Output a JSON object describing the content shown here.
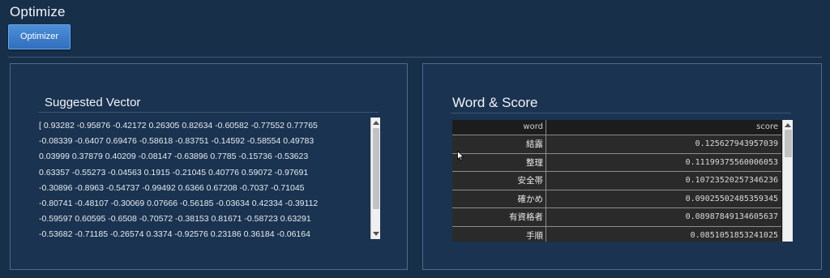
{
  "page": {
    "title": "Optimize",
    "optimize_button": "Optimizer"
  },
  "vector_panel": {
    "heading": "Suggested Vector",
    "lines": [
      "[ 0.93282 -0.95876 -0.42172 0.26305 0.82634 -0.60582 -0.77552 0.77765",
      "-0.08339 -0.6407 0.69476 -0.58618 -0.83751 -0.14592 -0.58554 0.49783",
      "0.03999 0.37879 0.40209 -0.08147 -0.63896 0.7785 -0.15736 -0.53623",
      "0.63357 -0.55273 -0.04563 0.1915 -0.21045 0.40776 0.59072 -0.97691",
      "-0.30896 -0.8963 -0.54737 -0.99492 0.6366 0.67208 -0.7037 -0.71045",
      "-0.80741 -0.48107 -0.30069 0.07666 -0.56185 -0.03634 0.42334 -0.39112",
      "-0.59597 0.60595 -0.6508 -0.70572 -0.38153 0.81671 -0.58723 0.63291",
      "-0.53682 -0.71185 -0.26574 0.3374 -0.92576 0.23186 0.36184 -0.06164"
    ]
  },
  "score_panel": {
    "heading": "Word & Score",
    "columns": [
      "word",
      "score"
    ],
    "rows": [
      {
        "word": "結露",
        "score": "0.125627943957039"
      },
      {
        "word": "整理",
        "score": "0.111993755600060​53"
      },
      {
        "word": "安全帯",
        "score": "0.10723520257346236"
      },
      {
        "word": "確かめ",
        "score": "0.09025502485359345"
      },
      {
        "word": "有資格者",
        "score": "0.08987849134605637"
      },
      {
        "word": "手順",
        "score": "0.0851051853241025"
      }
    ]
  }
}
